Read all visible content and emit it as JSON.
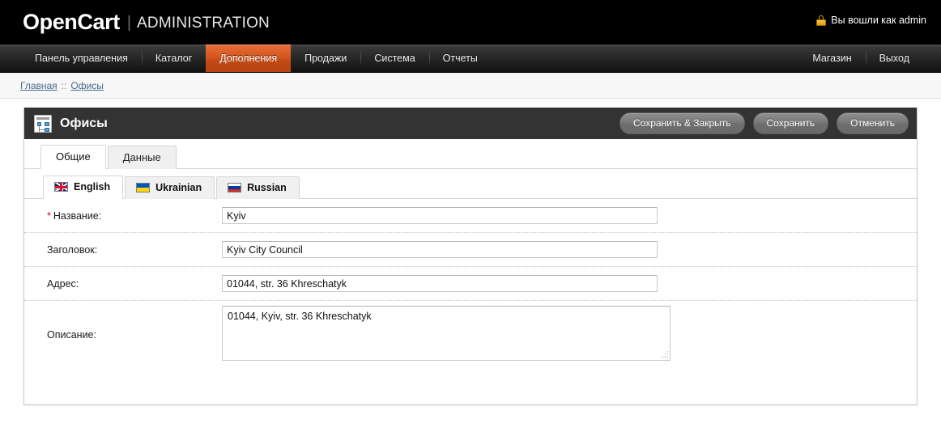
{
  "header": {
    "logo": "OpenCart",
    "separator": "|",
    "admin_label": "ADMINISTRATION",
    "login_status": "Вы вошли как admin",
    "lock_icon": "lock-icon"
  },
  "nav": {
    "left_items": [
      {
        "label": "Панель управления",
        "active": false
      },
      {
        "label": "Каталог",
        "active": false
      },
      {
        "label": "Дополнения",
        "active": true
      },
      {
        "label": "Продажи",
        "active": false
      },
      {
        "label": "Система",
        "active": false
      },
      {
        "label": "Отчеты",
        "active": false
      }
    ],
    "right_items": [
      {
        "label": "Магазин"
      },
      {
        "label": "Выход"
      }
    ],
    "active_color": "#d4561f"
  },
  "breadcrumb": {
    "items": [
      "Главная",
      "Офисы"
    ],
    "separator": "::"
  },
  "panel": {
    "icon": "sitemap-icon",
    "title": "Офисы",
    "buttons": [
      {
        "label": "Сохранить & Закрыть",
        "name": "save-and-close-button"
      },
      {
        "label": "Сохранить",
        "name": "save-button"
      },
      {
        "label": "Отменить",
        "name": "cancel-button"
      }
    ]
  },
  "tabs": [
    {
      "label": "Общие",
      "active": true
    },
    {
      "label": "Данные",
      "active": false
    }
  ],
  "language_tabs": [
    {
      "label": "English",
      "flag": "flag-uk",
      "active": true
    },
    {
      "label": "Ukrainian",
      "flag": "flag-ua",
      "active": false
    },
    {
      "label": "Russian",
      "flag": "flag-ru",
      "active": false
    }
  ],
  "form": {
    "fields": [
      {
        "label": "Название:",
        "required": true,
        "value": "Kyiv",
        "type": "text",
        "name": "name-field"
      },
      {
        "label": "Заголовок:",
        "required": false,
        "value": "Kyiv City Council",
        "type": "text",
        "name": "title-field"
      },
      {
        "label": "Адрес:",
        "required": false,
        "value": "01044, str. 36 Khreschatyk",
        "type": "text",
        "name": "address-field"
      },
      {
        "label": "Описание:",
        "required": false,
        "value": "01044, Kyiv, str. 36 Khreschatyk",
        "type": "textarea",
        "name": "description-field"
      }
    ]
  }
}
